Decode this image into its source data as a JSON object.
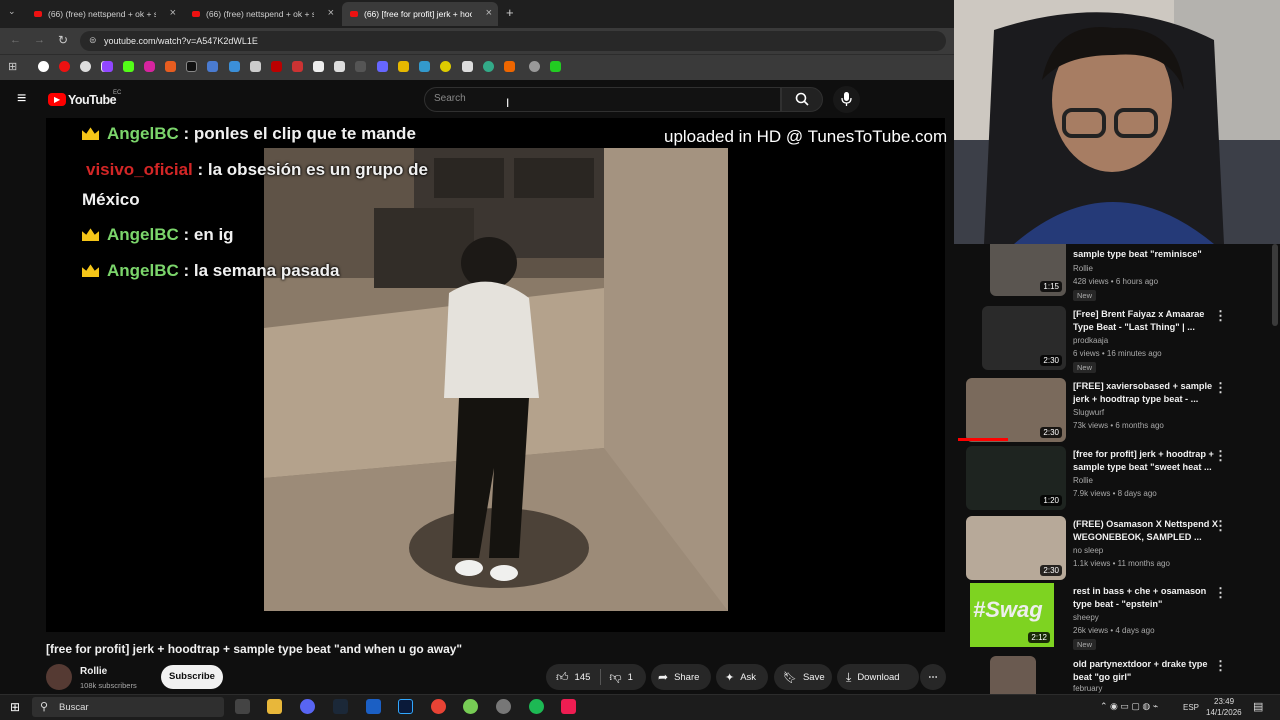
{
  "browser": {
    "tabs": [
      {
        "title": "(66) (free) nettspend + ok + sam"
      },
      {
        "title": "(66) (free) nettspend + ok + sam"
      },
      {
        "title": "(66) [free for profit] jerk + hoodt"
      }
    ],
    "url": "youtube.com/watch?v=A547K2dWL1E"
  },
  "youtube": {
    "logo": "YouTube",
    "country": "EC",
    "search_placeholder": "Search"
  },
  "player": {
    "chat": [
      {
        "user": "AngelBC",
        "text": ": ponles el clip que te mande"
      },
      {
        "user": "visivo_oficial",
        "text": ": la obsesión es un grupo de",
        "cont": "México"
      },
      {
        "user": "AngelBC",
        "text": ": en ig"
      },
      {
        "user": "AngelBC",
        "text": ": la semana pasada"
      }
    ],
    "watermark": "uploaded in HD @ TunesToTube.com"
  },
  "video": {
    "title": "[free for profit] jerk + hoodtrap + sample type beat \"and when u go away\"",
    "channel": "Rollie",
    "subscribers": "108k subscribers",
    "subscribe": "Subscribe",
    "likes": "145",
    "dislikes": "1",
    "share": "Share",
    "ask": "Ask",
    "save": "Save",
    "download": "Download"
  },
  "sidebar": [
    {
      "title": "sample type beat \"reminisce\"",
      "channel": "Rollie",
      "meta": "428 views • 6 hours ago",
      "new": "New",
      "duration": "1:15"
    },
    {
      "title": "[Free] Brent Faiyaz x Amaarae Type Beat - \"Last Thing\" | ...",
      "channel": "prodkaaja",
      "meta": "6 views • 16 minutes ago",
      "new": "New",
      "duration": "2:30"
    },
    {
      "title": "[FREE] xaviersobased + sample jerk + hoodtrap type beat - ...",
      "channel": "Slugwurf",
      "meta": "73k views • 6 months ago",
      "new": "",
      "duration": "2:30"
    },
    {
      "title": "[free for profit] jerk + hoodtrap + sample type beat \"sweet heat ...",
      "channel": "Rollie",
      "meta": "7.9k views • 8 days ago",
      "new": "",
      "duration": "1:20"
    },
    {
      "title": "(FREE) Osamason X Nettspend X WEGONEBEOK, SAMPLED ...",
      "channel": "no sleep",
      "meta": "1.1k views • 11 months ago",
      "new": "",
      "duration": "2:30"
    },
    {
      "title": "rest in bass + che + osamason type beat - \"epstein\"",
      "channel": "sheepy",
      "meta": "26k views • 4 days ago",
      "new": "New",
      "duration": "2:12"
    },
    {
      "title": "old partynextdoor + drake type beat \"go girl\"",
      "channel": "february",
      "meta": "",
      "new": "",
      "duration": ""
    }
  ],
  "thumb_text": "#Swag",
  "taskbar": {
    "search": "Buscar",
    "lang": "ESP",
    "time": "23:49",
    "date": "14/1/2026"
  }
}
